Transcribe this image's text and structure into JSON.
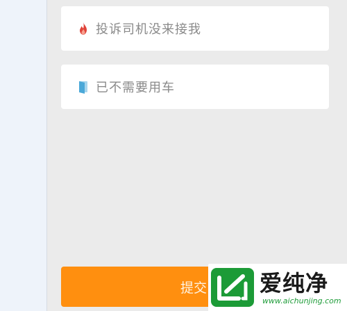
{
  "options": [
    {
      "label": "投诉司机没来接我",
      "icon": "flame-icon"
    },
    {
      "label": "已不需要用车",
      "icon": "door-icon"
    }
  ],
  "submit": {
    "label": "提交"
  },
  "watermark": {
    "title": "爱纯净",
    "domain": "www.aichunjing.com"
  },
  "colors": {
    "accent": "#ff8f0f",
    "flame": "#e0443a",
    "door": "#4aa8d8",
    "watermark_green": "#1c9b37"
  }
}
